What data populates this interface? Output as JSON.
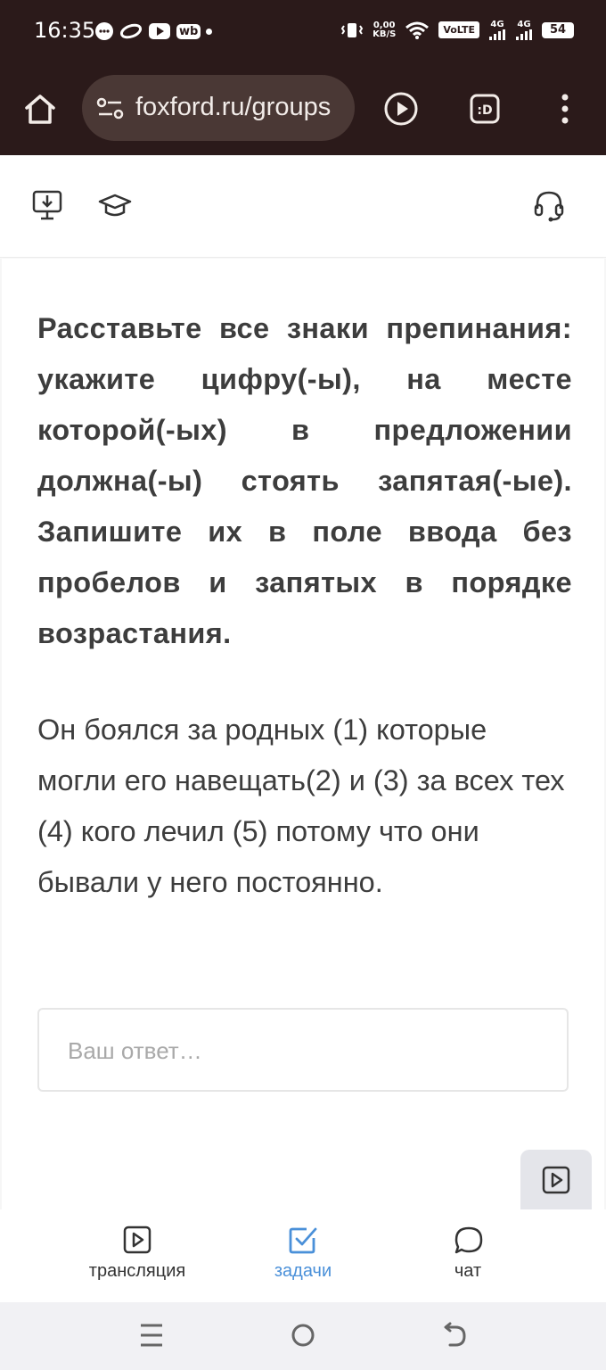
{
  "status_bar": {
    "time": "16:35",
    "net_speed_value": "0,00",
    "net_speed_unit": "KB/S",
    "volte": "VoLTE",
    "sim1_label": "4G",
    "sim2_label": "4G",
    "battery": "54",
    "notif_wb": "wb"
  },
  "browser": {
    "url": "foxford.ru/groups"
  },
  "task": {
    "instruction": "Расставьте все знаки препинания: укажите цифру(-ы), на месте которой(-ых) в предложении должна(-ы) стоять запятая(-ые). Запишите их в поле ввода без пробелов и запятых в порядке возрастания.",
    "sentence": "Он боялся за родных (1) которые могли его навещать(2) и (3) за всех тех (4) кого лечил (5) потому что они бывали у него постоянно.",
    "answer_placeholder": "Ваш ответ…",
    "answer_value": ""
  },
  "tabs": [
    {
      "label": "трансляция",
      "icon": "play-square-icon",
      "active": false
    },
    {
      "label": "задачи",
      "icon": "checkbox-icon",
      "active": true
    },
    {
      "label": "чат",
      "icon": "chat-bubble-icon",
      "active": false
    }
  ],
  "colors": {
    "browser_bg": "#2b1a1a",
    "url_pill": "#4a3835",
    "accent": "#4a90d9",
    "text": "#3d3d3d",
    "placeholder": "#a9a9a9"
  }
}
